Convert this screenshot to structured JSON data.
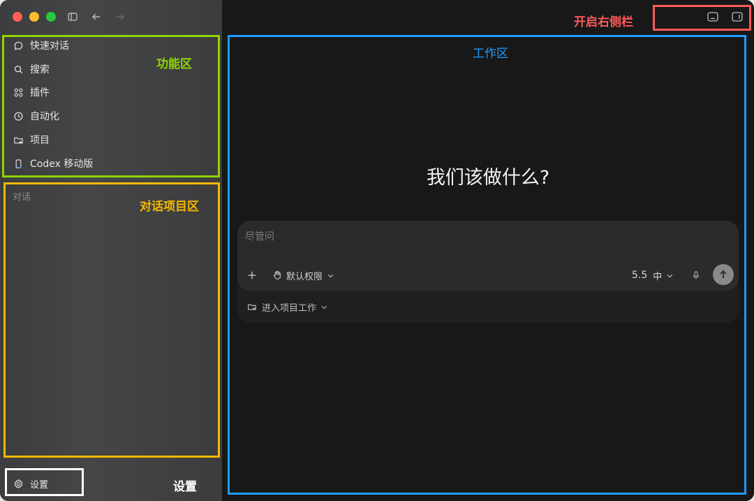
{
  "sidebar": {
    "items": [
      {
        "label": "快速对话",
        "icon": "chat-bubble-icon"
      },
      {
        "label": "搜索",
        "icon": "search-icon"
      },
      {
        "label": "插件",
        "icon": "plugins-grid-icon"
      },
      {
        "label": "自动化",
        "icon": "clock-icon"
      },
      {
        "label": "项目",
        "icon": "folder-add-icon"
      },
      {
        "label": "Codex 移动版",
        "icon": "mobile-phone-icon"
      }
    ],
    "section_label": "对话",
    "settings_label": "设置"
  },
  "annotations": {
    "function_area": "功能区",
    "conversation_area": "对话项目区",
    "settings": "设置",
    "workspace": "工作区",
    "right_sidebar": "开启右侧栏"
  },
  "main": {
    "heading": "我们该做什么?",
    "composer": {
      "placeholder": "尽管问",
      "permission_label": "默认权限",
      "model_version": "5.5",
      "model_speed": "中",
      "project_label": "进入项目工作"
    }
  },
  "colors": {
    "green": "#8fd400",
    "yellow": "#f5b800",
    "white": "#ffffff",
    "blue": "#1e9bff",
    "red": "#ff5a5a",
    "traffic_red": "#ff5f57",
    "traffic_yellow": "#febc2e",
    "traffic_green": "#28c840"
  }
}
